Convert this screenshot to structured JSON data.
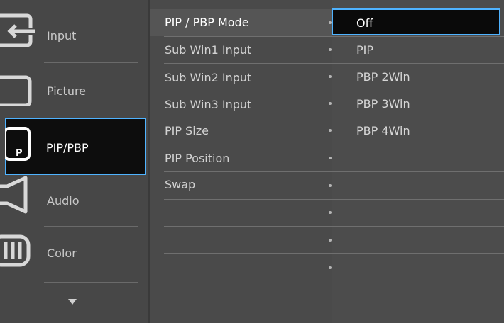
{
  "categories": [
    {
      "label": "Input",
      "icon": "input-icon"
    },
    {
      "label": "Picture",
      "icon": "picture-icon"
    },
    {
      "label": "PIP/PBP",
      "icon": "pip-icon",
      "icon_letter": "P",
      "selected": true
    },
    {
      "label": "Audio",
      "icon": "speaker-icon"
    },
    {
      "label": "Color",
      "icon": "color-icon"
    }
  ],
  "submenu": [
    {
      "label": "PIP / PBP Mode",
      "selected": true
    },
    {
      "label": "Sub Win1 Input"
    },
    {
      "label": "Sub Win2 Input"
    },
    {
      "label": "Sub Win3 Input"
    },
    {
      "label": "PIP Size"
    },
    {
      "label": "PIP Position"
    },
    {
      "label": "Swap"
    },
    {
      "label": ""
    },
    {
      "label": ""
    },
    {
      "label": ""
    }
  ],
  "options": [
    {
      "label": "Off",
      "selected": true
    },
    {
      "label": "PIP"
    },
    {
      "label": "PBP 2Win"
    },
    {
      "label": "PBP 3Win"
    },
    {
      "label": "PBP 4Win"
    }
  ],
  "colors": {
    "highlight_border": "#4fb3ff",
    "selected_background": "#0d0d0d",
    "panel_background": "#4b4b4b"
  }
}
